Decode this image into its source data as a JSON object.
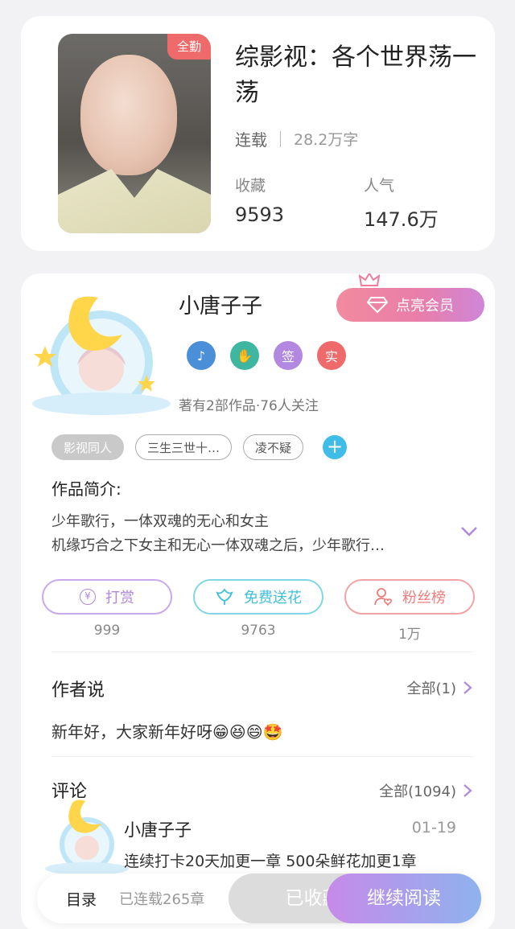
{
  "book": {
    "badge": "全勤",
    "title": "综影视：各个世界荡一荡",
    "status": "连载",
    "word_count": "28.2万字",
    "stats": [
      {
        "label": "收藏",
        "value": "9593"
      },
      {
        "label": "人气",
        "value": "147.6万"
      }
    ]
  },
  "author": {
    "name": "小唐子子",
    "vip_button": "点亮会员",
    "badges": [
      {
        "icon": "music-note-icon",
        "text": "",
        "color": "#4a8fd8"
      },
      {
        "icon": "handshake-icon",
        "text": "",
        "color": "#3fb7a0"
      },
      {
        "icon": "sign-badge",
        "text": "签",
        "color": "#b288e0"
      },
      {
        "icon": "real-name-badge",
        "text": "实",
        "color": "#ef6b6b"
      }
    ],
    "meta": "著有2部作品·76人关注",
    "tags": [
      "影视同人",
      "三生三世十…",
      "凌不疑"
    ],
    "intro_title": "作品简介:",
    "intro_lines": [
      "少年歌行，一体双魂的无心和女主",
      "机缘巧合之下女主和无心一体双魂之后，少年歌行…"
    ]
  },
  "actions": [
    {
      "label": "打赏",
      "count": "999",
      "icon": "yen-coin-icon",
      "color": "#b088dc"
    },
    {
      "label": "免费送花",
      "count": "9763",
      "icon": "flower-icon",
      "color": "#3fc0d8"
    },
    {
      "label": "粉丝榜",
      "count": "1万",
      "icon": "fan-heart-icon",
      "color": "#ef7b7b"
    }
  ],
  "author_says": {
    "title": "作者说",
    "more": "全部(1)",
    "text": "新年好，大家新年好呀😁😆😄🤩"
  },
  "comments": {
    "title": "评论",
    "more": "全部(1094)",
    "items": [
      {
        "name": "小唐子子",
        "date": "01-19",
        "text": "连续打卡20天加更一章 500朵鲜花加更1章"
      }
    ]
  },
  "bottom_bar": {
    "toc": "目录",
    "toc_sub": "已连载265章",
    "favorited": "已收藏",
    "continue": "继续阅读"
  }
}
